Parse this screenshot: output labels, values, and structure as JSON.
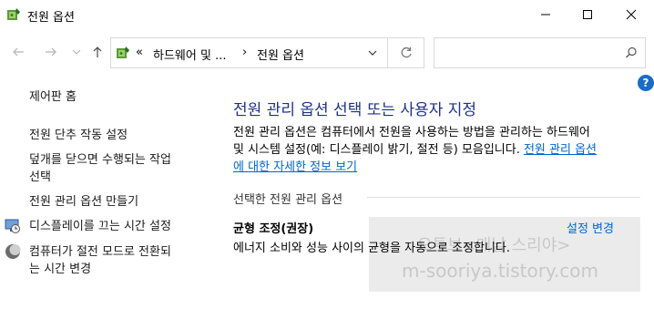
{
  "window": {
    "title": "전원 옵션"
  },
  "address": {
    "overflow": "«",
    "crumb1": "하드웨어 및 ...",
    "separator": "›",
    "crumb2": "전원 옵션"
  },
  "help": {
    "label": "?"
  },
  "sidebar": {
    "home": "제어판 홈",
    "items": [
      "전원 단추 작동 설정",
      "덮개를 닫으면 수행되는 작업",
      "선택",
      "전원 관리 옵션 만들기",
      "디스플레이를 끄는 시간 설정",
      "컴퓨터가 절전 모드로 전환되",
      "는 시간 변경"
    ]
  },
  "main": {
    "heading": "전원 관리 옵션 선택 또는 사용자 지정",
    "desc_line1": "전원 관리 옵션은 컴퓨터에서 전원을 사용하는 방법을 관리하는 하드웨어",
    "desc_line2": "및 시스템 설정(예: 디스플레이 밝기, 절전 등) 모음입니다. ",
    "desc_link_part1": "전원 관리 옵션",
    "desc_link_part2": "에 대한 자세한 정보 보기",
    "section_title": "선택한 전원 관리 옵션",
    "plan_name": "균형 조정(권장)",
    "plan_change": "설정 변경",
    "plan_desc": "에너지 소비와 성능 사이의 균형을 자동으로 조정합니다."
  },
  "watermark": {
    "line1": "오투브<매남 스리야>",
    "line2": "m-sooriya.tistory.com"
  },
  "colors": {
    "heading": "#1e3287",
    "link": "#0066cc",
    "help_bg": "#1a6cc7"
  }
}
